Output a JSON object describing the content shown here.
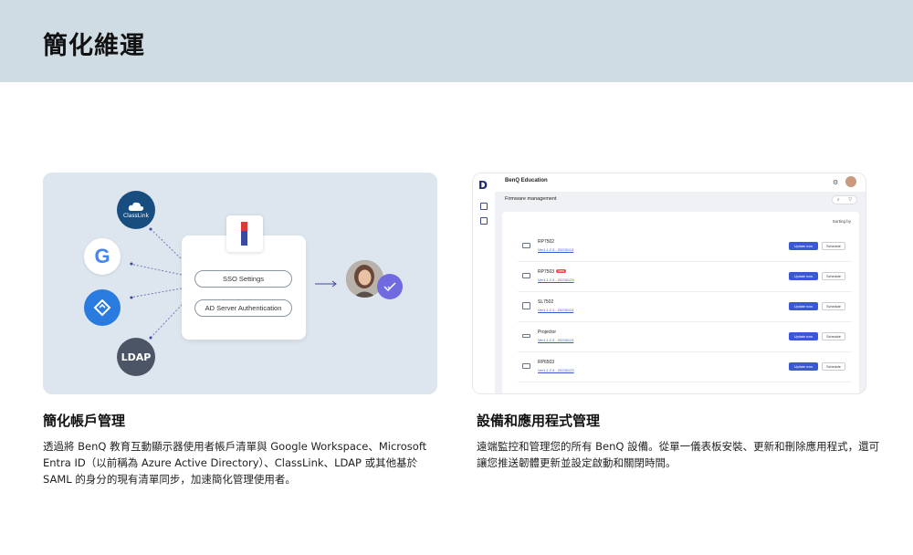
{
  "header": {
    "title": "簡化維運"
  },
  "left_card": {
    "classlink_cloud_label": "ClassLink",
    "google_letter": "G",
    "ldap_label": "LDAP",
    "sso_settings_label": "SSO Settings",
    "ad_auth_label": "AD Server Authentication"
  },
  "right_card": {
    "org_name": "BenQ Education",
    "section_title": "Firmware management",
    "sorting_label": "Sorting by",
    "rows": [
      {
        "name": "RP7502",
        "version": "Ver1.1.2.3 - 20230113",
        "badge": "",
        "update_label": "Update now",
        "schedule_label": "Schedule"
      },
      {
        "name": "RP7503",
        "version": "Ver1.1.2.4 - 20230123",
        "badge": "New",
        "update_label": "Update now",
        "schedule_label": "Schedule"
      },
      {
        "name": "SL7502",
        "version": "Ver1.1.2.1 - 20230113",
        "badge": "",
        "update_label": "Update now",
        "schedule_label": "Schedule"
      },
      {
        "name": "Projector",
        "version": "Ver1.1.2.3 - 20230113",
        "badge": "",
        "update_label": "Update now",
        "schedule_label": "Schedule"
      },
      {
        "name": "RP6503",
        "version": "Ver1.1.2.4 - 20230123",
        "badge": "",
        "update_label": "Update now",
        "schedule_label": "Schedule"
      }
    ]
  },
  "sections": {
    "left_title": "簡化帳戶管理",
    "left_desc": "透過將 BenQ 教育互動顯示器使用者帳戶清單與 Google Workspace、Microsoft Entra ID（以前稱為 Azure Active Directory）、ClassLink、LDAP 或其他基於 SAML 的身分的現有清單同步，加速簡化管理使用者。",
    "right_title": "設備和應用程式管理",
    "right_desc": "遠端監控和管理您的所有 BenQ 設備。從單一儀表板安裝、更新和刪除應用程式，還可讓您推送韌體更新並設定啟動和關閉時間。"
  },
  "colors": {
    "header_band": "#cfdce4",
    "left_card_bg": "#dde6ee",
    "accent_blue": "#3a58d6",
    "badge_purple": "#6f6ae0"
  }
}
